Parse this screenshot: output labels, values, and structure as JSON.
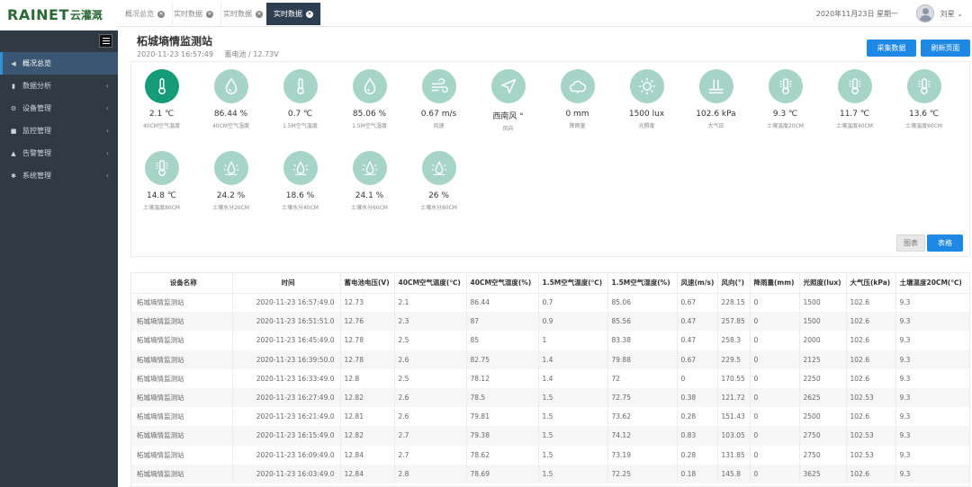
{
  "brand": {
    "logo_en": "RAINET",
    "logo_cn": "云灌溉"
  },
  "sidebar": {
    "items": [
      {
        "label": "概况总览",
        "icon": "paper-plane-icon",
        "icon_glyph": "◀",
        "active": true
      },
      {
        "label": "数据分析",
        "icon": "bar-chart-icon",
        "icon_glyph": "▮",
        "active": false
      },
      {
        "label": "设备管理",
        "icon": "gear-icon",
        "icon_glyph": "⚙",
        "active": false
      },
      {
        "label": "监控管理",
        "icon": "video-camera-icon",
        "icon_glyph": "■",
        "active": false
      },
      {
        "label": "告警管理",
        "icon": "warning-icon",
        "icon_glyph": "▲",
        "active": false
      },
      {
        "label": "系统管理",
        "icon": "cogs-icon",
        "icon_glyph": "✱",
        "active": false
      }
    ]
  },
  "tabs": [
    {
      "label": "概况总览",
      "active": false
    },
    {
      "label": "实时数据",
      "active": false
    },
    {
      "label": "实时数据",
      "active": false
    },
    {
      "label": "实时数据",
      "active": true
    }
  ],
  "header": {
    "date": "2020年11月23日 星期一",
    "user": "刘星 ⌄"
  },
  "station": {
    "title": "柘城墒情监测站",
    "time": "2020-11-23 16:57:49",
    "battery": "蓄电池 / 12.73V"
  },
  "buttons": {
    "collect": "采集数据",
    "refresh": "刷新页面",
    "chart": "图表",
    "table": "表格"
  },
  "sensors": [
    {
      "value": "2.1 ℃",
      "label": "40CM空气温度",
      "icon": "thermometer-icon",
      "highlight": true
    },
    {
      "value": "86.44 %",
      "label": "40CM空气湿度",
      "icon": "droplet-icon"
    },
    {
      "value": "0.7 ℃",
      "label": "1.5M空气温度",
      "icon": "thermometer-icon"
    },
    {
      "value": "85.06 %",
      "label": "1.5M空气湿度",
      "icon": "droplet-icon"
    },
    {
      "value": "0.67 m/s",
      "label": "风速",
      "icon": "wind-icon"
    },
    {
      "value": "西南风 °",
      "label": "风向",
      "icon": "navigation-arrow-icon"
    },
    {
      "value": "0 mm",
      "label": "降雨量",
      "icon": "cloud-icon"
    },
    {
      "value": "1500 lux",
      "label": "光照度",
      "icon": "sun-icon"
    },
    {
      "value": "102.6 kPa",
      "label": "大气压",
      "icon": "pressure-icon"
    },
    {
      "value": "9.3 ℃",
      "label": "土壤温度20CM",
      "icon": "soil-thermometer-icon"
    },
    {
      "value": "11.7 ℃",
      "label": "土壤温度40CM",
      "icon": "soil-thermometer-icon"
    },
    {
      "value": "13.6 ℃",
      "label": "土壤温度60CM",
      "icon": "soil-thermometer-icon"
    },
    {
      "value": "14.8 ℃",
      "label": "土壤温度80CM",
      "icon": "soil-thermometer-icon"
    },
    {
      "value": "24.2 %",
      "label": "土壤水分20CM",
      "icon": "soil-moisture-icon"
    },
    {
      "value": "18.6 %",
      "label": "土壤水分40CM",
      "icon": "soil-moisture-icon"
    },
    {
      "value": "24.1 %",
      "label": "土壤水分60CM",
      "icon": "soil-moisture-icon"
    },
    {
      "value": "26 %",
      "label": "土壤水分80CM",
      "icon": "soil-moisture-icon"
    }
  ],
  "table": {
    "headers": [
      "设备名称",
      "时间",
      "蓄电池电压(V)",
      "40CM空气温度(℃)",
      "40CM空气湿度(%)",
      "1.5M空气温度(℃)",
      "1.5M空气湿度(%)",
      "风速(m/s)",
      "风向(°)",
      "降雨量(mm)",
      "光照度(lux)",
      "大气压(kPa)",
      "土壤温度20CM(℃)"
    ],
    "rows": [
      [
        "柘城墒情监测站",
        "2020-11-23 16:57:49.0",
        "12.73",
        "2.1",
        "86.44",
        "0.7",
        "85.06",
        "0.67",
        "228.15",
        "0",
        "1500",
        "102.6",
        "9.3"
      ],
      [
        "柘城墒情监测站",
        "2020-11-23 16:51:51.0",
        "12.76",
        "2.3",
        "87",
        "0.9",
        "85.56",
        "0.47",
        "257.85",
        "0",
        "1500",
        "102.6",
        "9.3"
      ],
      [
        "柘城墒情监测站",
        "2020-11-23 16:45:49.0",
        "12.78",
        "2.5",
        "85",
        "1",
        "83.38",
        "0.47",
        "258.3",
        "0",
        "2000",
        "102.6",
        "9.3"
      ],
      [
        "柘城墒情监测站",
        "2020-11-23 16:39:50.0",
        "12.78",
        "2.6",
        "82.75",
        "1.4",
        "79.88",
        "0.67",
        "229.5",
        "0",
        "2125",
        "102.6",
        "9.3"
      ],
      [
        "柘城墒情监测站",
        "2020-11-23 16:33:49.0",
        "12.8",
        "2.5",
        "78.12",
        "1.4",
        "72",
        "0",
        "170.55",
        "0",
        "2250",
        "102.6",
        "9.3"
      ],
      [
        "柘城墒情监测站",
        "2020-11-23 16:27:49.0",
        "12.82",
        "2.6",
        "78.5",
        "1.5",
        "72.75",
        "0.38",
        "121.72",
        "0",
        "2625",
        "102.53",
        "9.3"
      ],
      [
        "柘城墒情监测站",
        "2020-11-23 16:21:49.0",
        "12.81",
        "2.6",
        "79.81",
        "1.5",
        "73.62",
        "0.28",
        "151.43",
        "0",
        "2500",
        "102.6",
        "9.3"
      ],
      [
        "柘城墒情监测站",
        "2020-11-23 16:15:49.0",
        "12.82",
        "2.7",
        "79.38",
        "1.5",
        "74.12",
        "0.83",
        "103.05",
        "0",
        "2750",
        "102.53",
        "9.3"
      ],
      [
        "柘城墒情监测站",
        "2020-11-23 16:09:49.0",
        "12.84",
        "2.7",
        "78.62",
        "1.5",
        "73.19",
        "0.28",
        "131.85",
        "0",
        "2750",
        "102.53",
        "9.3"
      ],
      [
        "柘城墒情监测站",
        "2020-11-23 16:03:49.0",
        "12.84",
        "2.8",
        "78.69",
        "1.5",
        "72.25",
        "0.18",
        "145.8",
        "0",
        "3625",
        "102.6",
        "9.3"
      ]
    ]
  },
  "colors": {
    "accent": "#1e88e5",
    "sidebar": "#2f3a45",
    "icon_bg": "#a6d4c7",
    "icon_bg_active": "#159b77"
  }
}
